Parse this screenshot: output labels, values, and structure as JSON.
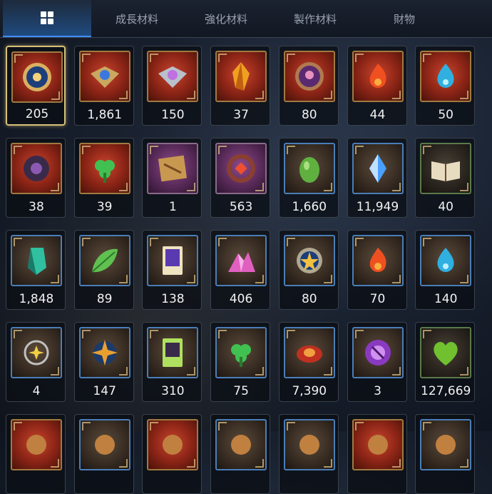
{
  "tabs": [
    {
      "label": "",
      "icon": "grid-icon",
      "active": true
    },
    {
      "label": "成長材料"
    },
    {
      "label": "強化材料"
    },
    {
      "label": "製作材料"
    },
    {
      "label": "財物"
    }
  ],
  "items": [
    {
      "count": "205",
      "icon": "sun-medallion-icon",
      "frame": "red",
      "selected": true
    },
    {
      "count": "1,861",
      "icon": "blue-eye-emblem-icon",
      "frame": "red"
    },
    {
      "count": "150",
      "icon": "silver-eye-emblem-icon",
      "frame": "red"
    },
    {
      "count": "37",
      "icon": "amber-crystal-icon",
      "frame": "red"
    },
    {
      "count": "80",
      "icon": "purple-pearl-medallion-icon",
      "frame": "red"
    },
    {
      "count": "44",
      "icon": "fire-charm-icon",
      "frame": "red"
    },
    {
      "count": "50",
      "icon": "water-charm-icon",
      "frame": "red"
    },
    {
      "count": "38",
      "icon": "dark-ring-charm-icon",
      "frame": "red"
    },
    {
      "count": "39",
      "icon": "clover-charm-icon",
      "frame": "red"
    },
    {
      "count": "1",
      "icon": "treasure-map-icon",
      "frame": "purple"
    },
    {
      "count": "563",
      "icon": "red-ring-charm-icon",
      "frame": "purple"
    },
    {
      "count": "1,660",
      "icon": "green-egg-gem-icon",
      "frame": "blue"
    },
    {
      "count": "11,949",
      "icon": "blue-crystal-gem-icon",
      "frame": "blue"
    },
    {
      "count": "40",
      "icon": "open-book-icon",
      "frame": "green"
    },
    {
      "count": "1,848",
      "icon": "teal-crystal-icon",
      "frame": "blue"
    },
    {
      "count": "89",
      "icon": "green-leaf-icon",
      "frame": "blue"
    },
    {
      "count": "138",
      "icon": "purple-card-icon",
      "frame": "blue"
    },
    {
      "count": "406",
      "icon": "pink-crystal-pile-icon",
      "frame": "blue"
    },
    {
      "count": "80",
      "icon": "star-medallion-icon",
      "frame": "blue"
    },
    {
      "count": "70",
      "icon": "fire-charm-icon",
      "frame": "blue"
    },
    {
      "count": "140",
      "icon": "water-charm-icon",
      "frame": "blue"
    },
    {
      "count": "4",
      "icon": "star-charm-icon",
      "frame": "blue"
    },
    {
      "count": "147",
      "icon": "compass-star-charm-icon",
      "frame": "blue"
    },
    {
      "count": "310",
      "icon": "green-card-icon",
      "frame": "blue"
    },
    {
      "count": "75",
      "icon": "clover-charm-icon",
      "frame": "blue"
    },
    {
      "count": "7,390",
      "icon": "red-bracelet-icon",
      "frame": "blue"
    },
    {
      "count": "3",
      "icon": "purple-seal-icon",
      "frame": "blue"
    },
    {
      "count": "127,669",
      "icon": "green-heart-icon",
      "frame": "green"
    },
    {
      "count": "",
      "icon": "partial-item-icon",
      "frame": "red"
    },
    {
      "count": "",
      "icon": "partial-item-icon",
      "frame": "blue"
    },
    {
      "count": "",
      "icon": "partial-item-icon",
      "frame": "red"
    },
    {
      "count": "",
      "icon": "partial-item-icon",
      "frame": "blue"
    },
    {
      "count": "",
      "icon": "partial-item-icon",
      "frame": "blue"
    },
    {
      "count": "",
      "icon": "partial-item-icon",
      "frame": "red"
    },
    {
      "count": "",
      "icon": "partial-item-icon",
      "frame": "blue"
    }
  ]
}
